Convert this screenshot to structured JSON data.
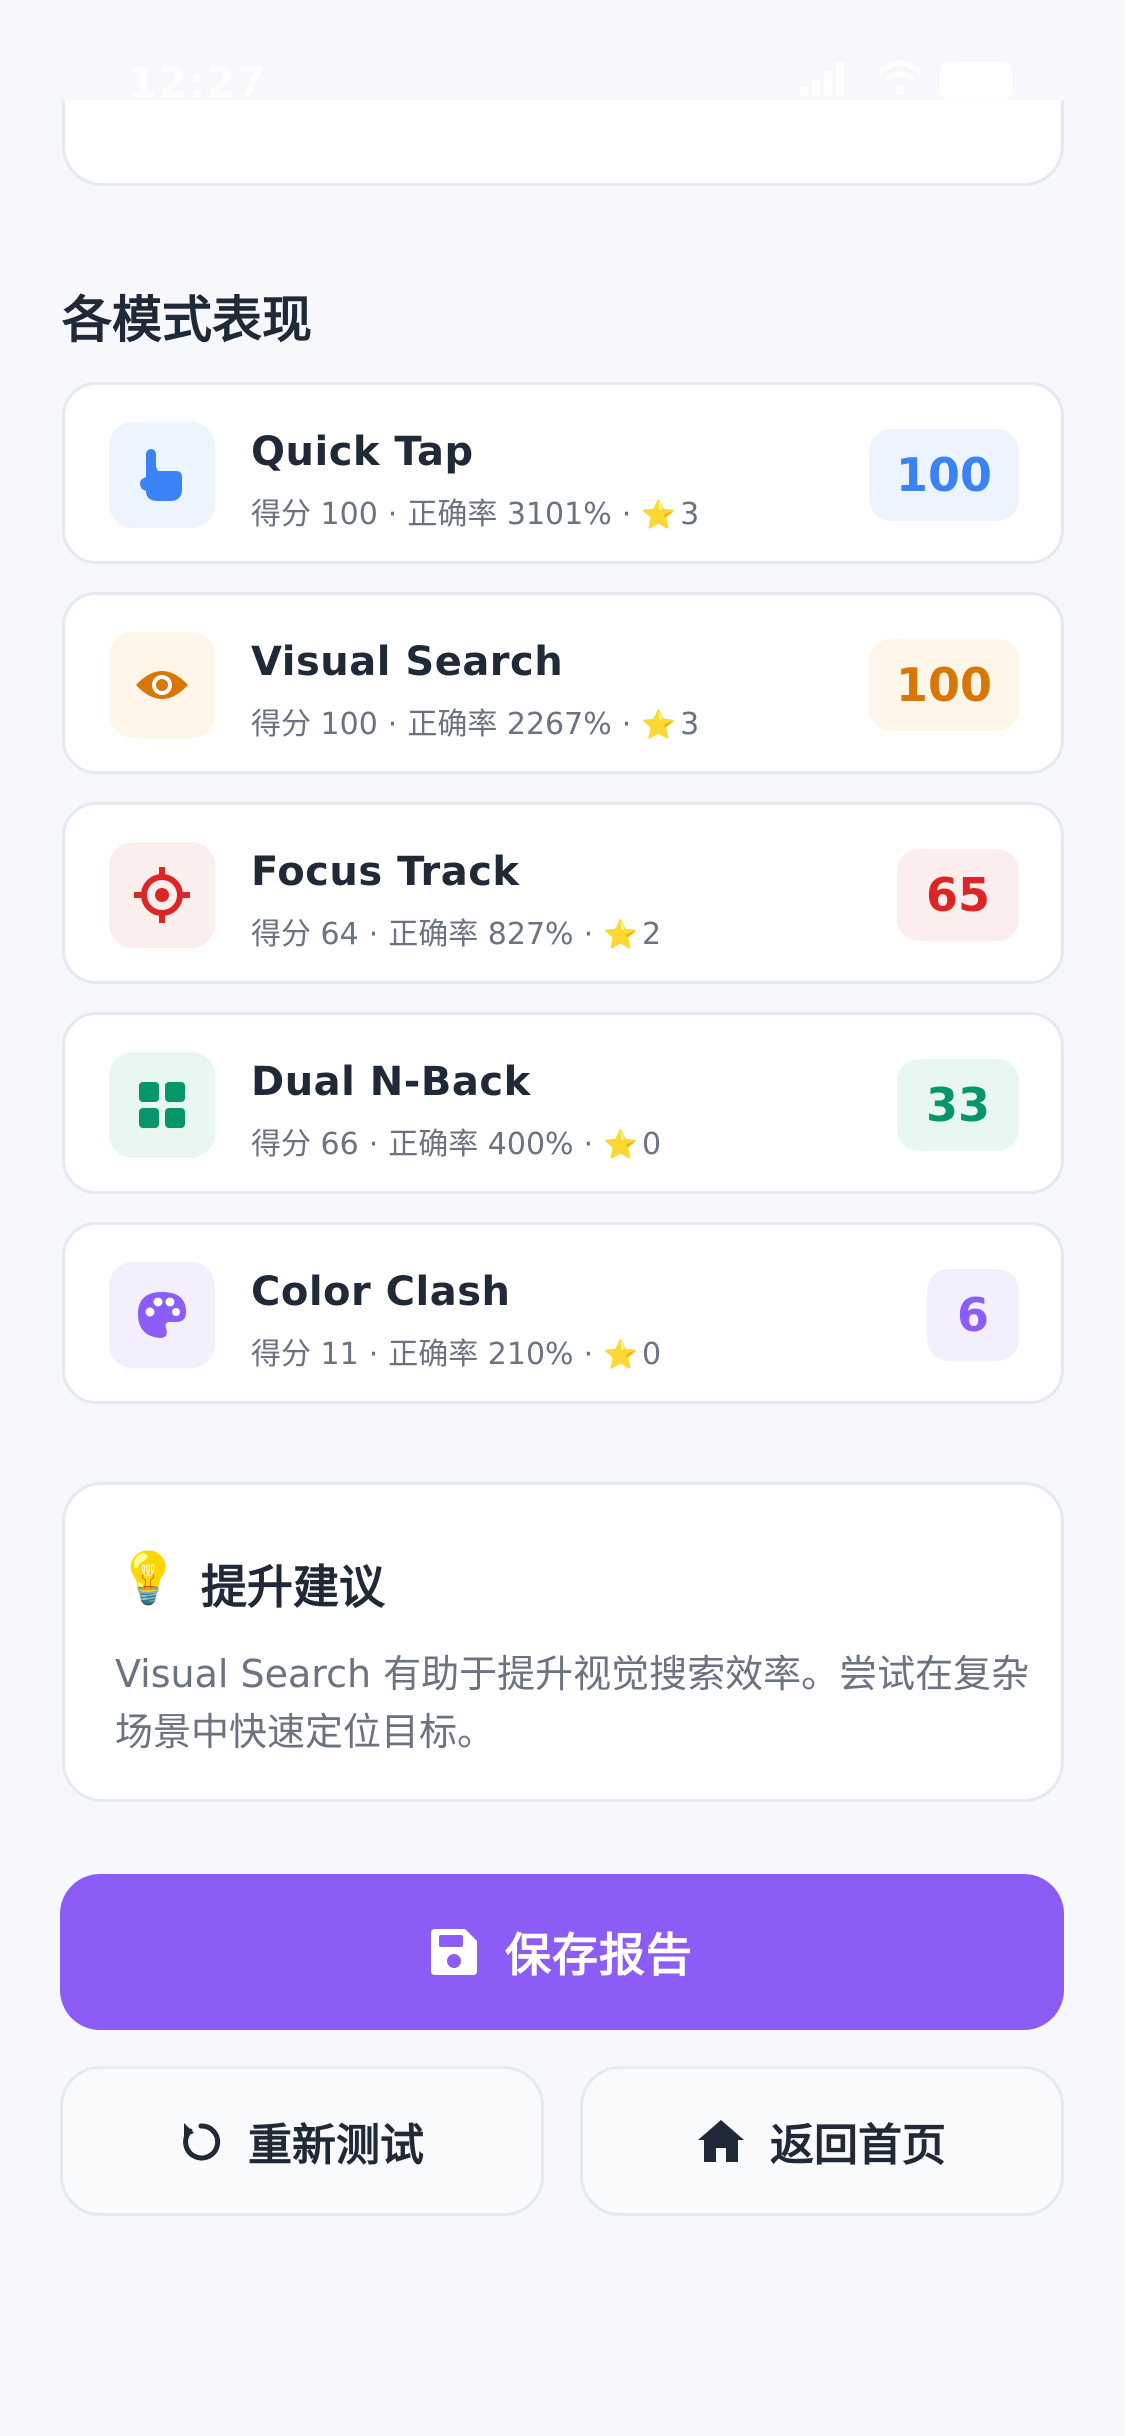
{
  "status_bar": {
    "time": "12:27"
  },
  "section_title": "各模式表现",
  "modes": [
    {
      "name": "Quick Tap",
      "score_label": "得分 100",
      "accuracy_label": "正确率 3101%",
      "stars": "3",
      "badge": "100",
      "icon": "hand-tap-icon",
      "accent": "#3b82f6",
      "bg": "#eef4ff"
    },
    {
      "name": "Visual Search",
      "score_label": "得分 100",
      "accuracy_label": "正确率 2267%",
      "stars": "3",
      "badge": "100",
      "icon": "eye-icon",
      "accent": "#d97706",
      "bg": "#fff5e8"
    },
    {
      "name": "Focus Track",
      "score_label": "得分 64",
      "accuracy_label": "正确率 827%",
      "stars": "2",
      "badge": "65",
      "icon": "crosshair-icon",
      "accent": "#dc2626",
      "bg": "#fdeeee"
    },
    {
      "name": "Dual N-Back",
      "score_label": "得分 66",
      "accuracy_label": "正确率 400%",
      "stars": "0",
      "badge": "33",
      "icon": "grid-icon",
      "accent": "#059669",
      "bg": "#e9f7f1"
    },
    {
      "name": "Color Clash",
      "score_label": "得分 11",
      "accuracy_label": "正确率 210%",
      "stars": "0",
      "badge": "6",
      "icon": "palette-icon",
      "accent": "#8b5cf6",
      "bg": "#f4efff"
    }
  ],
  "tip": {
    "title": "提升建议",
    "text": "Visual Search 有助于提升视觉搜索效率。尝试在复杂场景中快速定位目标。"
  },
  "buttons": {
    "save": "保存报告",
    "retest": "重新测试",
    "home": "返回首页"
  }
}
